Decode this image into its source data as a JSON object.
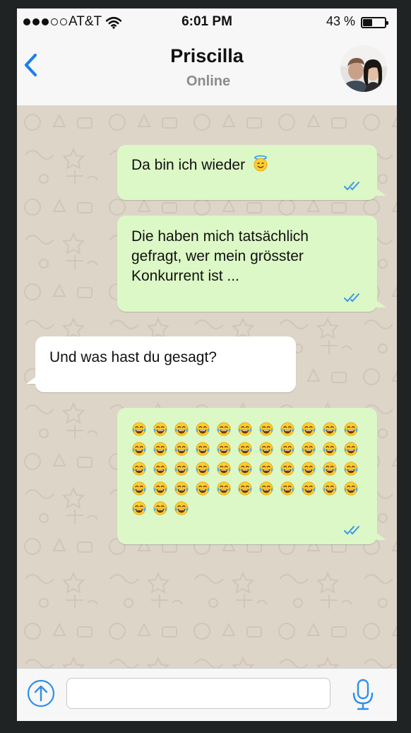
{
  "statusbar": {
    "carrier": "AT&T",
    "time": "6:01 PM",
    "battery": "43 %",
    "battery_level": 0.43,
    "signal_bars": 3
  },
  "header": {
    "back_icon": "chevron-left-icon",
    "name": "Priscilla",
    "status": "Online"
  },
  "messages": [
    {
      "direction": "out",
      "text": "Da bin ich wieder",
      "emoji": "smiling-face-with-halo",
      "ticks": "double-check-blue"
    },
    {
      "direction": "out",
      "text": "Die haben mich tatsächlich\ngefragt, wer mein grösster\nKonkurrent ist ...",
      "ticks": "double-check-blue"
    },
    {
      "direction": "in",
      "text": "Und was hast du gesagt?"
    },
    {
      "direction": "out",
      "emoji": "face-with-tears-of-joy",
      "emoji_count": 47,
      "ticks": "double-check-blue"
    }
  ],
  "inputbar": {
    "upload_icon": "upload-arrow-icon",
    "placeholder": "",
    "mic_icon": "microphone-icon"
  },
  "colors": {
    "accent": "#2f8fe8",
    "outgoing_bubble": "#dcf8c6",
    "incoming_bubble": "#ffffff",
    "chat_background": "#ded5c9"
  }
}
